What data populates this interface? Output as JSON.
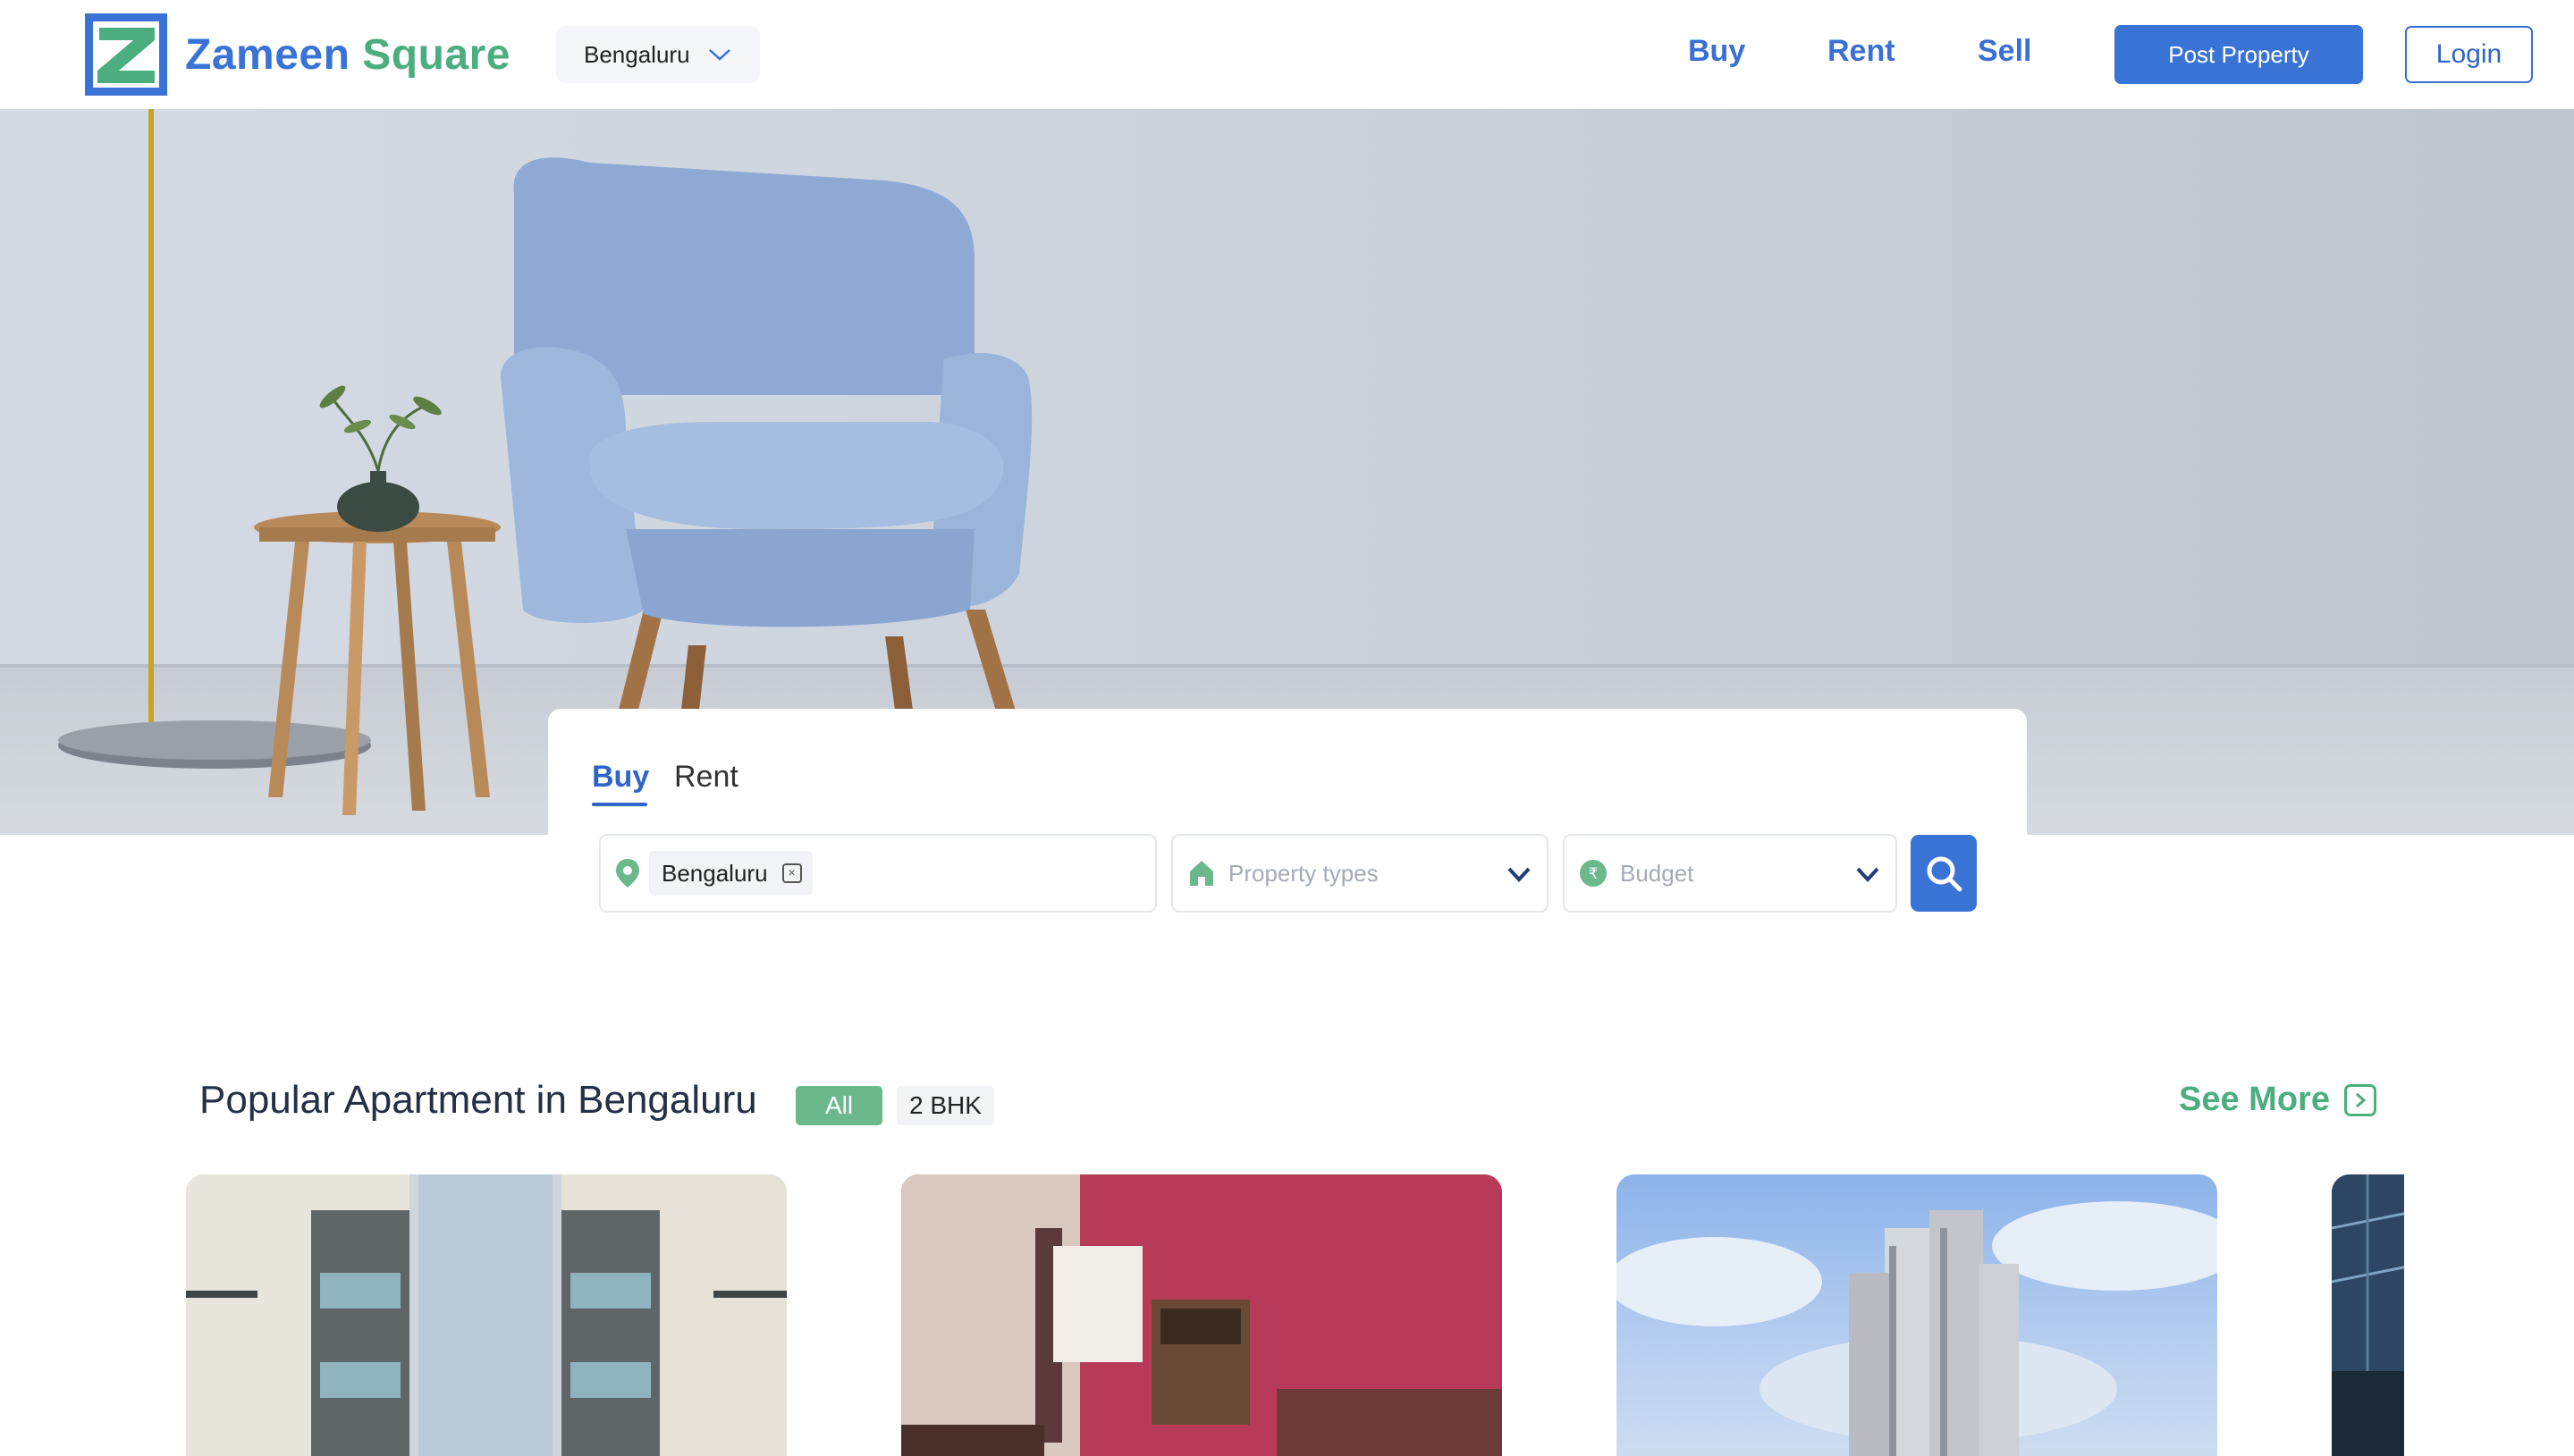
{
  "header": {
    "brand": {
      "word1": "Zameen",
      "word2": "Square"
    },
    "city_selector": {
      "value": "Bengaluru",
      "icon": "chevron-down-icon"
    },
    "nav": [
      {
        "label": "Buy"
      },
      {
        "label": "Rent"
      },
      {
        "label": "Sell"
      }
    ],
    "post_property_label": "Post Property",
    "login_label": "Login"
  },
  "search": {
    "tabs": [
      {
        "label": "Buy",
        "active": true
      },
      {
        "label": "Rent",
        "active": false
      }
    ],
    "location": {
      "chip": "Bengaluru",
      "icon": "location-pin-icon"
    },
    "property_types": {
      "placeholder": "Property types",
      "icon": "home-icon"
    },
    "budget": {
      "placeholder": "Budget",
      "icon": "rupee-icon"
    },
    "search_button_icon": "search-icon"
  },
  "popular": {
    "title": "Popular Apartment in Bengaluru",
    "filters": [
      {
        "label": "All",
        "active": true
      },
      {
        "label": "2 BHK",
        "active": false
      }
    ],
    "see_more_label": "See More",
    "cards": [
      {
        "image": "apartment-exterior"
      },
      {
        "image": "living-room-interior"
      },
      {
        "image": "high-rise-tower"
      },
      {
        "image": "glass-building"
      }
    ]
  },
  "colors": {
    "primary_blue": "#3a73d6",
    "brand_green": "#4cae80",
    "pill_green": "#6ab88c"
  }
}
